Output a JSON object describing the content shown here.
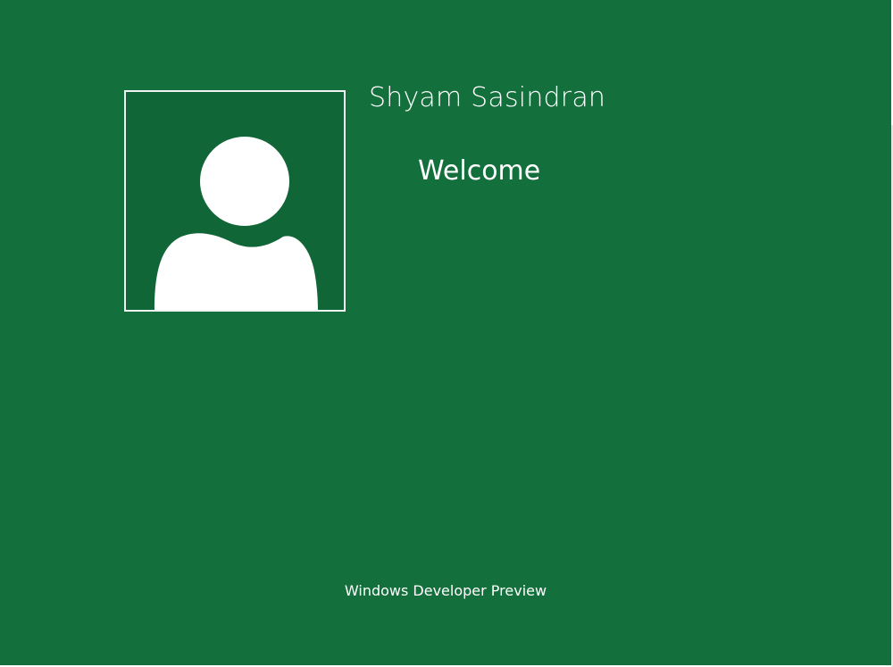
{
  "colors": {
    "background": "#136f3b",
    "tile_background": "#106636",
    "tile_border": "#f2f2f2",
    "silhouette": "#ffffff",
    "text": "#ffffff"
  },
  "user": {
    "name": "Shyam Sasindran",
    "avatar_icon": "user-silhouette-icon"
  },
  "status": {
    "message": "Welcome"
  },
  "footer": {
    "text": "Windows Developer Preview"
  }
}
